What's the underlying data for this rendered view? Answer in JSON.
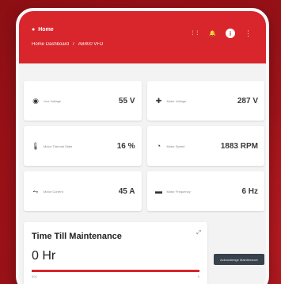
{
  "appbar": {
    "title": "Home",
    "breadcrumb": [
      "Home Dashboard",
      "/",
      "AB400 VFD"
    ],
    "actions": [
      "⋮⋮",
      "🔔",
      "i",
      "⋮"
    ]
  },
  "metrics": [
    {
      "icon": "gauge-icon",
      "glyph": "◉",
      "label": "Line Voltage",
      "value": "55 V"
    },
    {
      "icon": "motor-voltage-icon",
      "glyph": "✚",
      "label": "Motor Voltage",
      "value": "287 V"
    },
    {
      "icon": "thermometer-icon",
      "glyph": "🌡",
      "label": "Motor Thermal State",
      "value": "16 %"
    },
    {
      "icon": "speedometer-icon",
      "glyph": "◔",
      "label": "Motor Speed",
      "value": "1883 RPM"
    },
    {
      "icon": "current-icon",
      "glyph": "⥊",
      "label": "Motor Current",
      "value": "45 A"
    },
    {
      "icon": "frequency-icon",
      "glyph": "▬",
      "label": "Motor Frequency",
      "value": "6 Hz"
    }
  ],
  "maintenance": {
    "title": "Time Till Maintenance",
    "value": "0 Hr",
    "progress_fraction": 1.0,
    "scale_min": "500",
    "scale_max": "0",
    "expand_glyph": "⤢"
  },
  "acknowledge_button": "Acknowledge Maintenance"
}
